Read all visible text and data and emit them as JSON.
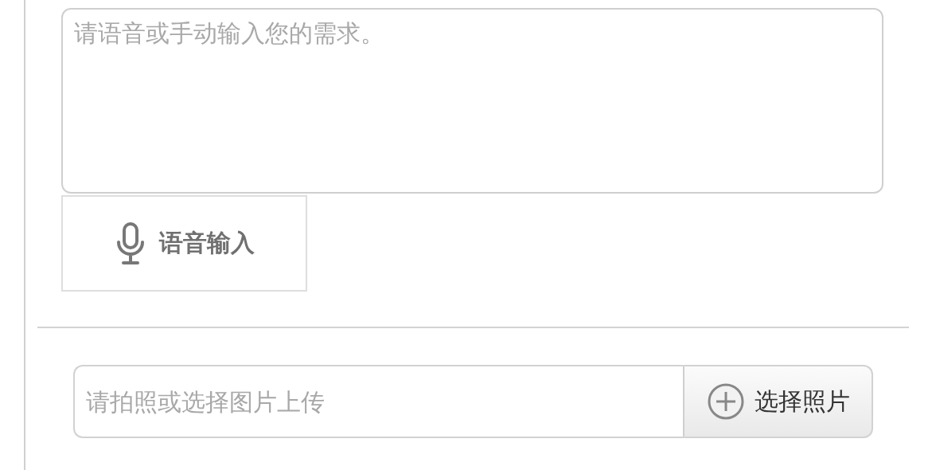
{
  "request": {
    "placeholder": "请语音或手动输入您的需求。"
  },
  "voice_button": {
    "label": "语音输入"
  },
  "photo_upload": {
    "placeholder": "请拍照或选择图片上传",
    "button": "选择照片"
  }
}
